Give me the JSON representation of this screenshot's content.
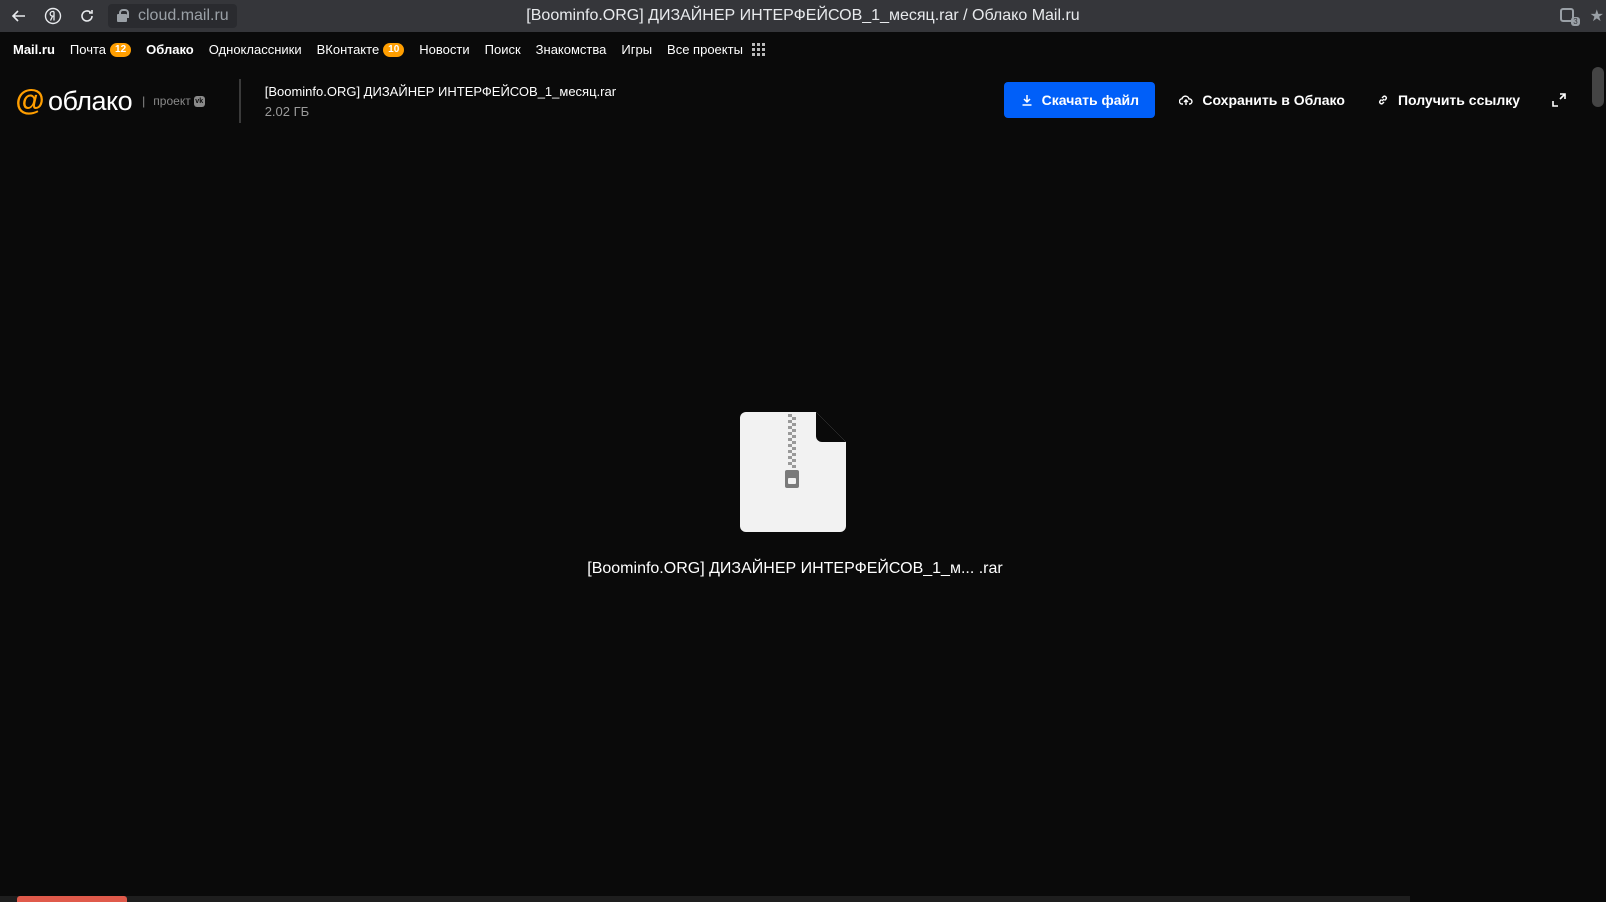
{
  "browser": {
    "url": "cloud.mail.ru",
    "tab_title": "[Boominfo.ORG] ДИЗАЙНЕР ИНТЕРФЕЙСОВ_1_месяц.rar / Облако Mail.ru",
    "extension_count": "3",
    "icons": [
      "back-arrow-icon",
      "yandex-icon",
      "reload-icon",
      "lock-icon",
      "extension-icon",
      "star-icon"
    ]
  },
  "portal": {
    "items": [
      {
        "label": "Mail.ru",
        "bold": true
      },
      {
        "label": "Почта",
        "badge": "12"
      },
      {
        "label": "Облако",
        "bold": true
      },
      {
        "label": "Одноклассники"
      },
      {
        "label": "ВКонтакте",
        "badge": "10"
      },
      {
        "label": "Новости"
      },
      {
        "label": "Поиск"
      },
      {
        "label": "Знакомства"
      },
      {
        "label": "Игры"
      },
      {
        "label": "Все проекты"
      }
    ]
  },
  "header": {
    "logo_symbol": "@",
    "logo_text": "облако",
    "logo_separator": "|",
    "logo_project": "проект",
    "file_name": "[Boominfo.ORG] ДИЗАЙНЕР ИНТЕРФЕЙСОВ_1_месяц.rar",
    "file_size": "2.02 ГБ",
    "download_label": "Скачать файл",
    "save_label": "Сохранить в Облако",
    "link_label": "Получить ссылку"
  },
  "preview": {
    "file_name_truncated": "[Boominfo.ORG] ДИЗАЙНЕР ИНТЕРФЕЙСОВ_1_м... .rar"
  },
  "colors": {
    "accent": "#005ff9",
    "brand": "#ff9e00",
    "background": "#0a0a0a"
  }
}
